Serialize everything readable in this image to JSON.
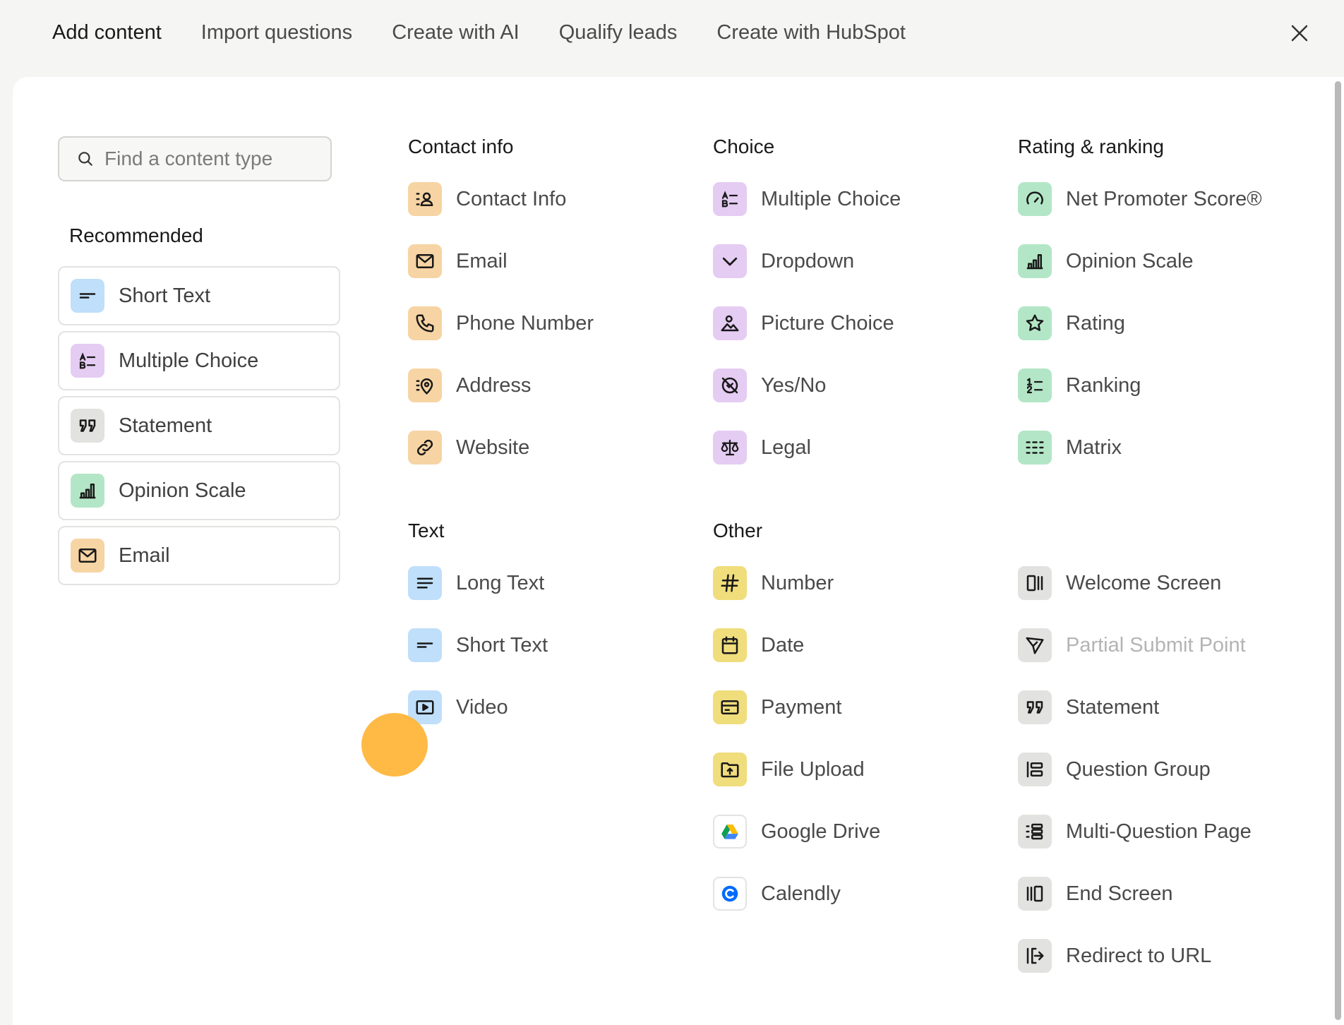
{
  "tabs": [
    {
      "label": "Add content",
      "active": true
    },
    {
      "label": "Import questions",
      "active": false
    },
    {
      "label": "Create with AI",
      "active": false
    },
    {
      "label": "Qualify leads",
      "active": false
    },
    {
      "label": "Create with HubSpot",
      "active": false
    }
  ],
  "search": {
    "placeholder": "Find a content type",
    "value": ""
  },
  "recommended": {
    "title": "Recommended",
    "items": [
      {
        "label": "Short Text",
        "icon": "short-text-icon",
        "color": "blue"
      },
      {
        "label": "Multiple Choice",
        "icon": "multiple-choice-icon",
        "color": "purple"
      },
      {
        "label": "Statement",
        "icon": "quote-icon",
        "color": "gray"
      },
      {
        "label": "Opinion Scale",
        "icon": "bar-chart-icon",
        "color": "green"
      },
      {
        "label": "Email",
        "icon": "envelope-icon",
        "color": "orange"
      }
    ]
  },
  "sections": {
    "contact_info": {
      "title": "Contact info",
      "items": [
        {
          "label": "Contact Info",
          "icon": "contact-icon"
        },
        {
          "label": "Email",
          "icon": "envelope-icon"
        },
        {
          "label": "Phone Number",
          "icon": "phone-icon"
        },
        {
          "label": "Address",
          "icon": "location-pin-icon"
        },
        {
          "label": "Website",
          "icon": "link-icon"
        }
      ]
    },
    "choice": {
      "title": "Choice",
      "items": [
        {
          "label": "Multiple Choice",
          "icon": "multiple-choice-icon"
        },
        {
          "label": "Dropdown",
          "icon": "chevron-down-icon"
        },
        {
          "label": "Picture Choice",
          "icon": "picture-icon"
        },
        {
          "label": "Yes/No",
          "icon": "yes-no-icon"
        },
        {
          "label": "Legal",
          "icon": "scale-icon"
        }
      ]
    },
    "rating": {
      "title": "Rating & ranking",
      "items": [
        {
          "label": "Net Promoter Score®",
          "icon": "gauge-icon"
        },
        {
          "label": "Opinion Scale",
          "icon": "bar-chart-icon"
        },
        {
          "label": "Rating",
          "icon": "star-icon"
        },
        {
          "label": "Ranking",
          "icon": "ranking-icon"
        },
        {
          "label": "Matrix",
          "icon": "matrix-icon"
        }
      ]
    },
    "text": {
      "title": "Text",
      "items": [
        {
          "label": "Long Text",
          "icon": "long-text-icon"
        },
        {
          "label": "Short Text",
          "icon": "short-text-icon"
        },
        {
          "label": "Video",
          "icon": "video-icon"
        }
      ]
    },
    "other": {
      "title": "Other",
      "items": [
        {
          "label": "Number",
          "icon": "hash-icon"
        },
        {
          "label": "Date",
          "icon": "calendar-icon"
        },
        {
          "label": "Payment",
          "icon": "credit-card-icon"
        },
        {
          "label": "File Upload",
          "icon": "folder-upload-icon"
        },
        {
          "label": "Google Drive",
          "icon": "google-drive-icon"
        },
        {
          "label": "Calendly",
          "icon": "calendly-icon"
        }
      ]
    },
    "screens": {
      "items": [
        {
          "label": "Welcome Screen",
          "icon": "welcome-screen-icon",
          "disabled": false
        },
        {
          "label": "Partial Submit Point",
          "icon": "send-icon",
          "disabled": true
        },
        {
          "label": "Statement",
          "icon": "quote-icon",
          "disabled": false
        },
        {
          "label": "Question Group",
          "icon": "question-group-icon",
          "disabled": false
        },
        {
          "label": "Multi-Question Page",
          "icon": "multi-question-icon",
          "disabled": false
        },
        {
          "label": "End Screen",
          "icon": "end-screen-icon",
          "disabled": false
        },
        {
          "label": "Redirect to URL",
          "icon": "redirect-icon",
          "disabled": false
        }
      ]
    }
  },
  "colors": {
    "blue": "#bfdffb",
    "purple": "#e5ccf3",
    "gray": "#e2e2e0",
    "green": "#b3e6c6",
    "orange": "#f7d4a4",
    "yellow": "#f0dd7c",
    "cursor": "#ffb63c"
  }
}
